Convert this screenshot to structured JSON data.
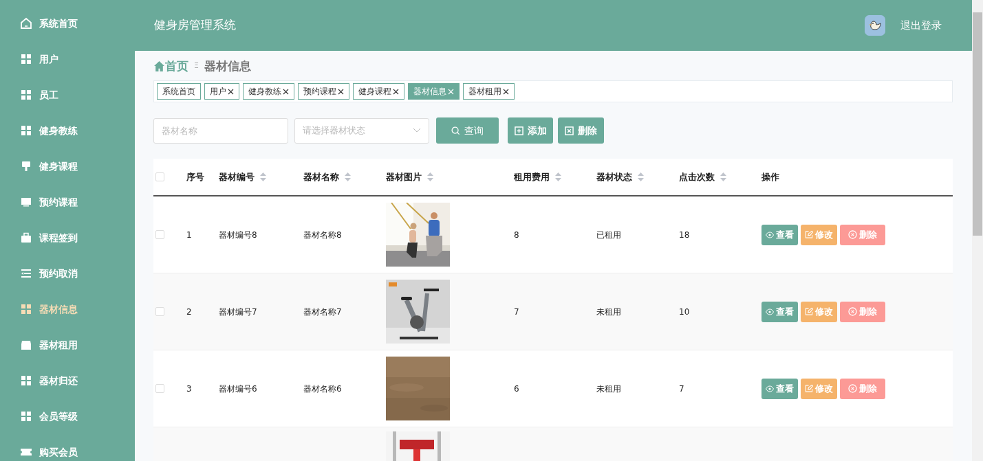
{
  "sidebar": {
    "items": [
      {
        "label": "系统首页",
        "selected": false
      },
      {
        "label": "用户",
        "selected": false
      },
      {
        "label": "员工",
        "selected": false
      },
      {
        "label": "健身教练",
        "selected": false
      },
      {
        "label": "健身课程",
        "selected": false
      },
      {
        "label": "预约课程",
        "selected": false
      },
      {
        "label": "课程签到",
        "selected": false
      },
      {
        "label": "预约取消",
        "selected": false
      },
      {
        "label": "器材信息",
        "selected": true
      },
      {
        "label": "器材租用",
        "selected": false
      },
      {
        "label": "器材归还",
        "selected": false
      },
      {
        "label": "会员等级",
        "selected": false
      },
      {
        "label": "购买会员",
        "selected": false
      }
    ]
  },
  "header": {
    "title": "健身房管理系统",
    "logout": "退出登录"
  },
  "breadcrumb": {
    "home": "首页",
    "separator": "Ξ",
    "current": "器材信息"
  },
  "tags": [
    {
      "label": "系统首页",
      "closable": false,
      "selected": false
    },
    {
      "label": "用户",
      "closable": true,
      "selected": false
    },
    {
      "label": "健身教练",
      "closable": true,
      "selected": false
    },
    {
      "label": "预约课程",
      "closable": true,
      "selected": false
    },
    {
      "label": "健身课程",
      "closable": true,
      "selected": false
    },
    {
      "label": "器材信息",
      "closable": true,
      "selected": true
    },
    {
      "label": "器材租用",
      "closable": true,
      "selected": false
    }
  ],
  "search": {
    "name_placeholder": "器材名称",
    "status_placeholder": "请选择器材状态",
    "query": "查询",
    "add": "添加",
    "delete": "删除"
  },
  "table": {
    "all_checked": false,
    "columns": [
      {
        "label": "序号",
        "sortable": false
      },
      {
        "label": "器材编号",
        "sortable": true
      },
      {
        "label": "器材名称",
        "sortable": true
      },
      {
        "label": "器材图片",
        "sortable": true
      },
      {
        "label": "租用费用",
        "sortable": true
      },
      {
        "label": "器材状态",
        "sortable": true
      },
      {
        "label": "点击次数",
        "sortable": true
      },
      {
        "label": "操作",
        "sortable": false
      }
    ],
    "rows": [
      {
        "checked": false,
        "index": "1",
        "code": "器材编号8",
        "name": "器材名称8",
        "fee": "8",
        "status": "已租用",
        "clicks": "18",
        "actions": [
          "查看",
          "修改",
          "删除"
        ]
      },
      {
        "checked": false,
        "index": "2",
        "code": "器材编号7",
        "name": "器材名称7",
        "fee": "7",
        "status": "未租用",
        "clicks": "10",
        "actions": [
          "查看",
          "修改",
          "删除"
        ]
      },
      {
        "checked": false,
        "index": "3",
        "code": "器材编号6",
        "name": "器材名称6",
        "fee": "6",
        "status": "未租用",
        "clicks": "7",
        "actions": [
          "查看",
          "修改",
          "删除"
        ]
      },
      {
        "kind": "picture"
      }
    ]
  }
}
